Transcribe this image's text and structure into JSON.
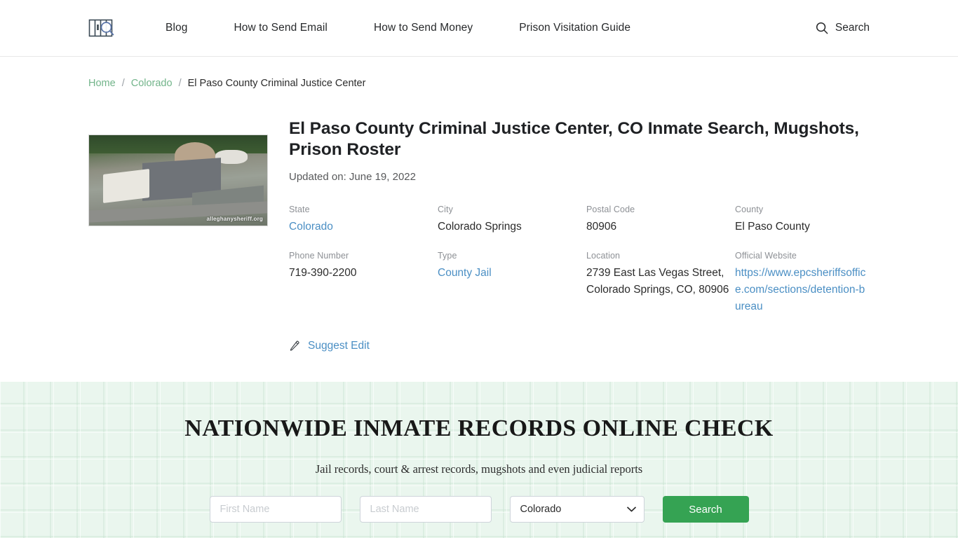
{
  "header": {
    "logo_alt": "prison-bars-search-logo",
    "nav": [
      {
        "label": "Blog"
      },
      {
        "label": "How to Send Email"
      },
      {
        "label": "How to Send Money"
      },
      {
        "label": "Prison Visitation Guide"
      }
    ],
    "search_label": "Search"
  },
  "breadcrumb": {
    "home": "Home",
    "state": "Colorado",
    "current": "El Paso County Criminal Justice Center",
    "separator": "/"
  },
  "facility": {
    "title": "El Paso County Criminal Justice Center, CO Inmate Search, Mugshots, Prison Roster",
    "updated": "Updated on: June 19, 2022",
    "photo_watermark": "alleghanysheriff.org",
    "fields": [
      {
        "label": "State",
        "value": "Colorado",
        "is_link": true
      },
      {
        "label": "City",
        "value": "Colorado Springs",
        "is_link": false
      },
      {
        "label": "Postal Code",
        "value": "80906",
        "is_link": false
      },
      {
        "label": "County",
        "value": "El Paso County",
        "is_link": false
      },
      {
        "label": "Phone Number",
        "value": "719-390-2200",
        "is_link": false
      },
      {
        "label": "Type",
        "value": "County Jail",
        "is_link": true
      },
      {
        "label": "Location",
        "value": "2739 East Las Vegas Street, Colorado Springs, CO, 80906",
        "is_link": false
      },
      {
        "label": "Official Website",
        "value": "https://www.epcsheriffsoffice.com/sections/detention-bureau",
        "is_link": true
      }
    ],
    "suggest_edit_label": "Suggest Edit",
    "suggest_edit_icon": "pencil-icon"
  },
  "hero": {
    "title": "NATIONWIDE INMATE RECORDS ONLINE CHECK",
    "subtitle": "Jail records, court & arrest records, mugshots and even judicial reports",
    "first_name_placeholder": "First Name",
    "first_name_value": "",
    "last_name_placeholder": "Last Name",
    "last_name_value": "",
    "state_selected": "Colorado",
    "state_options": [
      "Colorado"
    ],
    "search_button": "Search"
  },
  "colors": {
    "accent_green": "#35a353",
    "link_blue": "#4b8fc4",
    "breadcrumb_green": "#72b48a",
    "hero_bg": "#eaf6ee"
  }
}
